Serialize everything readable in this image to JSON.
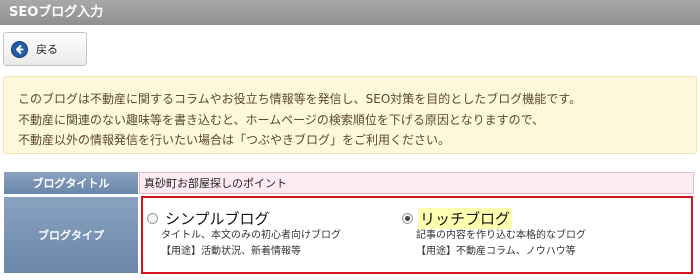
{
  "window": {
    "title": "SEOブログ入力"
  },
  "toolbar": {
    "back_label": "戻る"
  },
  "notice": {
    "lines": [
      "このブログは不動産に関するコラムやお役立ち情報等を発信し、SEO対策を目的としたブログ機能です。",
      "不動産に関連のない趣味等を書き込むと、ホームページの検索順位を下げる原因となりますので、",
      "不動産以外の情報発信を行いたい場合は「つぶやきブログ」をご利用ください。"
    ]
  },
  "form": {
    "blog_title": {
      "label": "ブログタイトル",
      "value": "真砂町お部屋探しのポイント"
    },
    "blog_type": {
      "label": "ブログタイプ",
      "selected": "rich",
      "options": [
        {
          "id": "simple",
          "title": "シンプルブログ",
          "description": "タイトル、本文のみの初心者向けブログ",
          "usage": "【用途】活動状況、新着情報等"
        },
        {
          "id": "rich",
          "title": "リッチブログ",
          "description": "記事の内容を作り込む本格的なブログ",
          "usage": "【用途】不動産コラム、ノウハウ等"
        }
      ]
    }
  },
  "colors": {
    "titlebar": "#9a9a9a",
    "label_cell": "#7a94b5",
    "notice_bg": "#fdf7dc",
    "title_input_bg": "#fcebf1",
    "highlight_border": "#d6141d",
    "selected_highlight": "#ffffb0"
  },
  "icons": {
    "back": "arrow-left-circle"
  }
}
